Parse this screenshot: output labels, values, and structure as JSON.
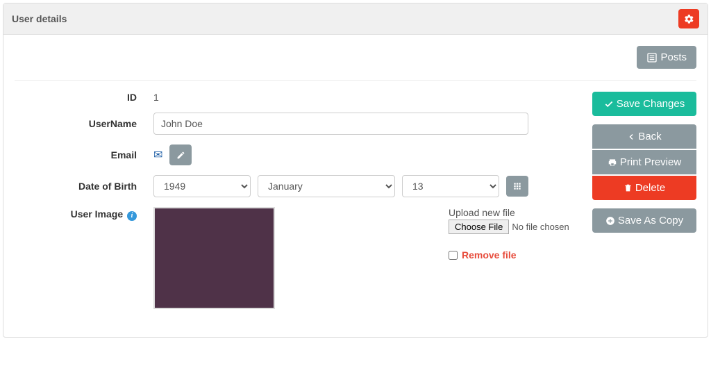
{
  "panel": {
    "title": "User details"
  },
  "topActions": {
    "posts": "Posts"
  },
  "form": {
    "id": {
      "label": "ID",
      "value": "1"
    },
    "username": {
      "label": "UserName",
      "value": "John Doe"
    },
    "email": {
      "label": "Email"
    },
    "dob": {
      "label": "Date of Birth",
      "year": "1949",
      "month": "January",
      "day": "13"
    },
    "image": {
      "label": "User Image",
      "uploadLabel": "Upload new file",
      "chooseFile": "Choose File",
      "noFile": "No file chosen",
      "removeLabel": "Remove file"
    }
  },
  "actions": {
    "save": "Save Changes",
    "back": "Back",
    "print": "Print Preview",
    "delete": "Delete",
    "saveCopy": "Save As Copy"
  },
  "colors": {
    "green": "#1abc9c",
    "red": "#ed3b23",
    "gray": "#8b999f",
    "imagePreview": "#4f3248"
  }
}
